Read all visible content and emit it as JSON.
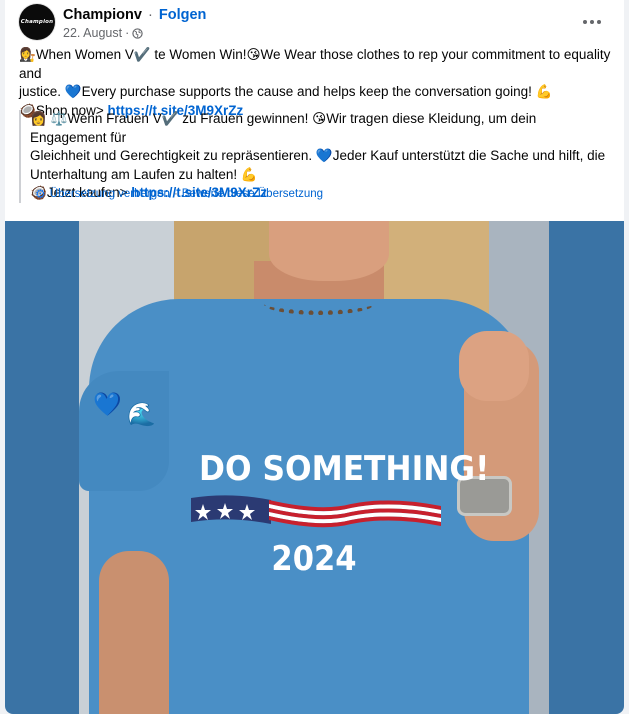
{
  "post": {
    "page_name": "Championv",
    "follow_label": "Folgen",
    "date": "22. August",
    "avatar_text": "Champion"
  },
  "text": {
    "line1_a": "When Women V",
    "line1_b": " te Women Win!",
    "line1_c": "We Wear those clothes to rep your commitment to equality and",
    "line2_a": "justice. ",
    "line2_b": "Every purchase supports the cause and helps keep the conversation going! ",
    "line3_a": "Shop now> ",
    "link": "https://t.site/3M9XrZz"
  },
  "translation": {
    "line1_a": "Wenn Frauen V",
    "line1_b": " zu Frauen gewinnen! ",
    "line1_c": "Wir tragen diese Kleidung, um dein Engagement für",
    "line2_a": "Gleichheit und Gerechtigkeit zu repräsentieren. ",
    "line2_b": "Jeder Kauf unterstützt die Sache und hilft, die",
    "line3": "Unterhaltung am Laufen zu halten! ",
    "line4_a": "Jetzt kaufen> ",
    "link": "https://t.site/3M9XrZz",
    "hide_label": "Übersetzung verbergen",
    "separator": "·",
    "rate_label": "Bewerte diese Übersetzung"
  },
  "image": {
    "slogan": "DO SOMETHING!",
    "year": "2024"
  },
  "icons": [
    "globe-icon",
    "more-options-icon",
    "gear-icon",
    "heart-icon",
    "wave-icon",
    "flag-icon"
  ],
  "colors": {
    "link": "#0064d1",
    "shirt": "#4a8fc6",
    "background_blue": "#3a73a5"
  }
}
